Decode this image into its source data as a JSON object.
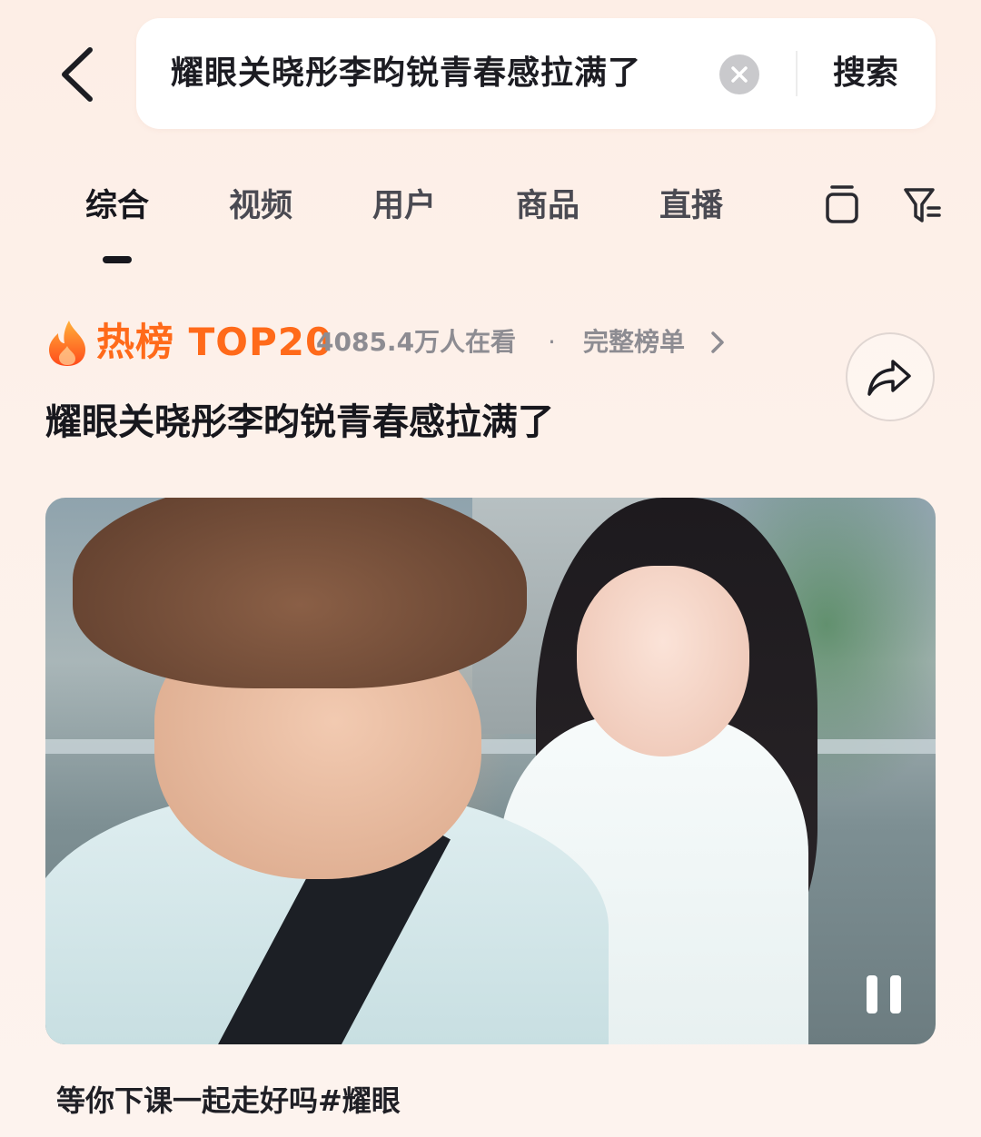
{
  "header": {
    "search_value": "耀眼关晓彤李昀锐青春感拉满了",
    "search_button": "搜索",
    "back_icon": "chevron-left-icon",
    "clear_icon": "close-circle-icon"
  },
  "tabs": {
    "items": [
      {
        "label": "综合",
        "active": true
      },
      {
        "label": "视频",
        "active": false
      },
      {
        "label": "用户",
        "active": false
      },
      {
        "label": "商品",
        "active": false
      },
      {
        "label": "直播",
        "active": false
      }
    ],
    "extra_icons": [
      "stack-icon",
      "filter-icon"
    ]
  },
  "hot": {
    "badge_label": "热榜",
    "rank_label": "TOP20",
    "viewers": "4085.4万人在看",
    "separator": "·",
    "full_list_label": "完整榜单",
    "topic_title": "耀眼关晓彤李昀锐青春感拉满了",
    "accent_color": "#ff6a1a"
  },
  "video": {
    "state": "playing",
    "caption": "等你下课一起走好吗#耀眼"
  }
}
